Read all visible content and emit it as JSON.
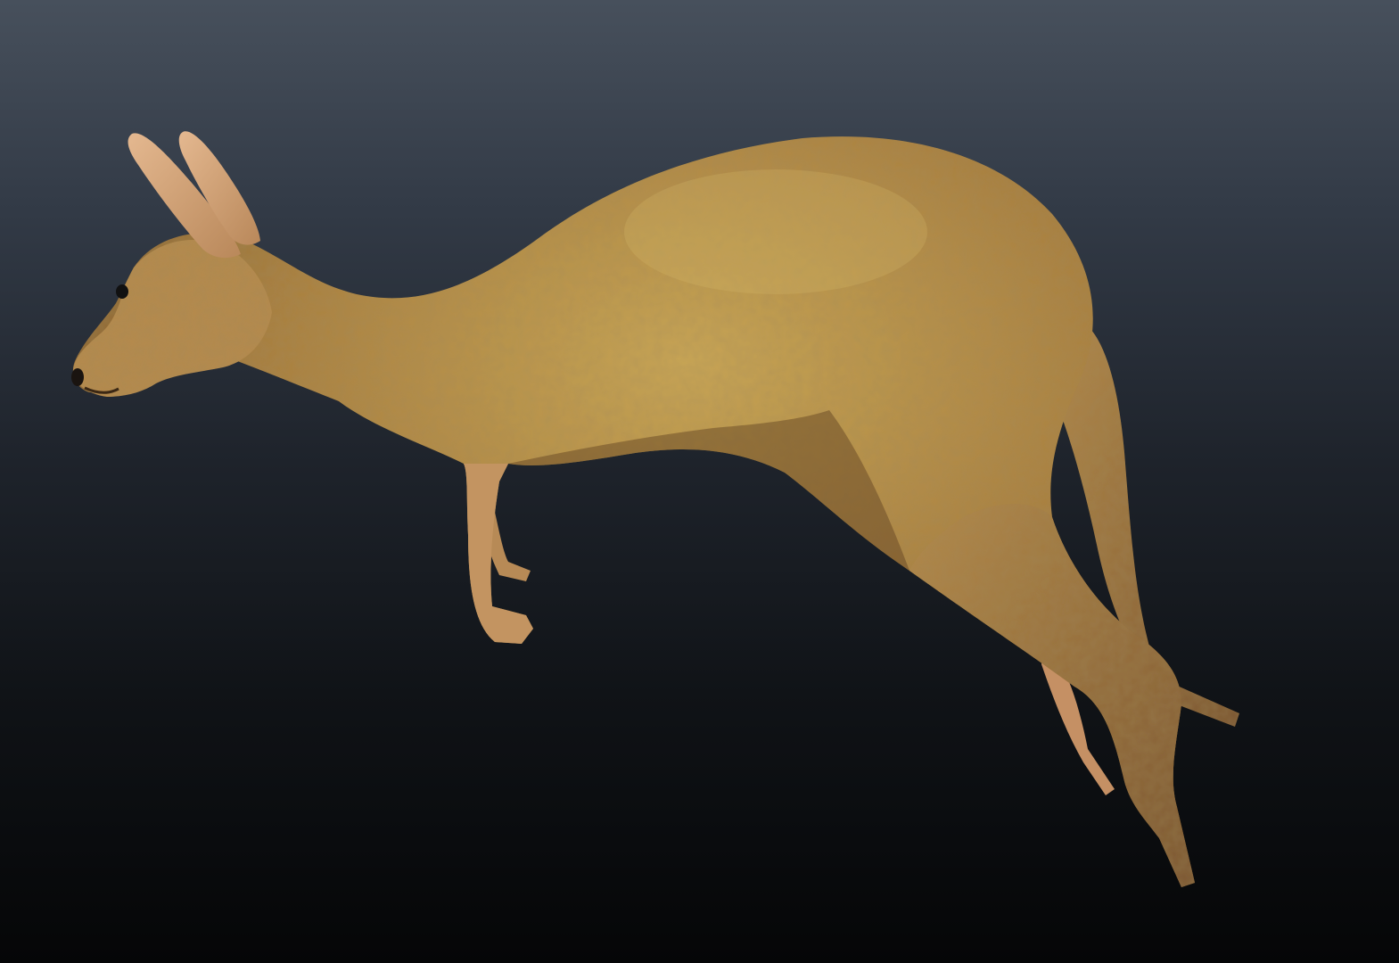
{
  "scene": {
    "subject_icon": "kangaroo-model-icon",
    "colors": {
      "background_top": "#47505c",
      "background_bottom": "#050607",
      "fur_light": "#c8a052",
      "fur_mid": "#a57a3c",
      "fur_dark": "#6e4a24",
      "skin_pale": "#e2b48a",
      "eye": "#111111"
    }
  }
}
